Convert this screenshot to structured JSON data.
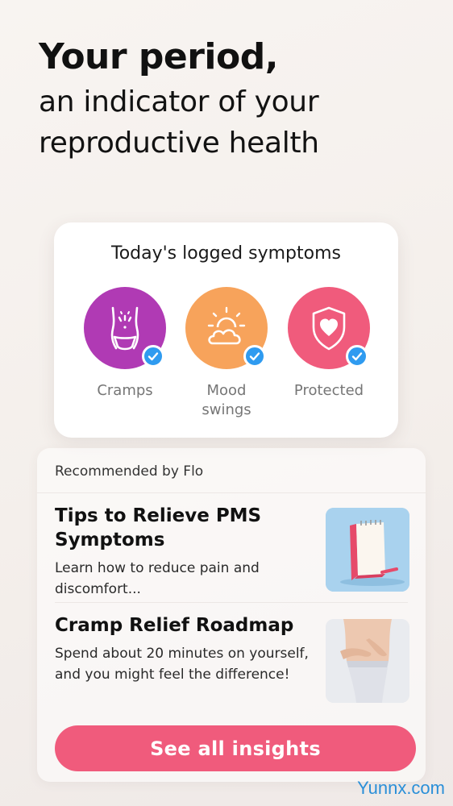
{
  "headline": {
    "title": "Your period,",
    "subtitle_line1": "an indicator of your",
    "subtitle_line2": "reproductive health"
  },
  "symptoms_card": {
    "title": "Today's logged symptoms",
    "items": [
      {
        "label_line1": "Cramps",
        "label_line2": "",
        "color": "#b03ab4",
        "icon": "cramps-body-icon",
        "checked": true
      },
      {
        "label_line1": "Mood",
        "label_line2": "swings",
        "color": "#f7a35b",
        "icon": "sun-cloud-icon",
        "checked": true
      },
      {
        "label_line1": "Protected",
        "label_line2": "",
        "color": "#f05b7c",
        "icon": "shield-heart-icon",
        "checked": true
      }
    ]
  },
  "recommendations": {
    "header": "Recommended by Flo",
    "articles": [
      {
        "title": "Tips to Relieve PMS Symptoms",
        "desc": "Learn how to reduce pain and discomfort...",
        "thumb": "notepad-pencil-image"
      },
      {
        "title": "Cramp Relief Roadmap",
        "desc": "Spend about 20 minutes on yourself, and you might feel the difference!",
        "thumb": "woman-holding-belly-image"
      }
    ],
    "button_label": "See all insights"
  },
  "watermark": "Yunnx.com",
  "colors": {
    "accent": "#f05b7c",
    "check_blue": "#2f9bf0",
    "purple": "#b03ab4",
    "orange": "#f7a35b"
  }
}
